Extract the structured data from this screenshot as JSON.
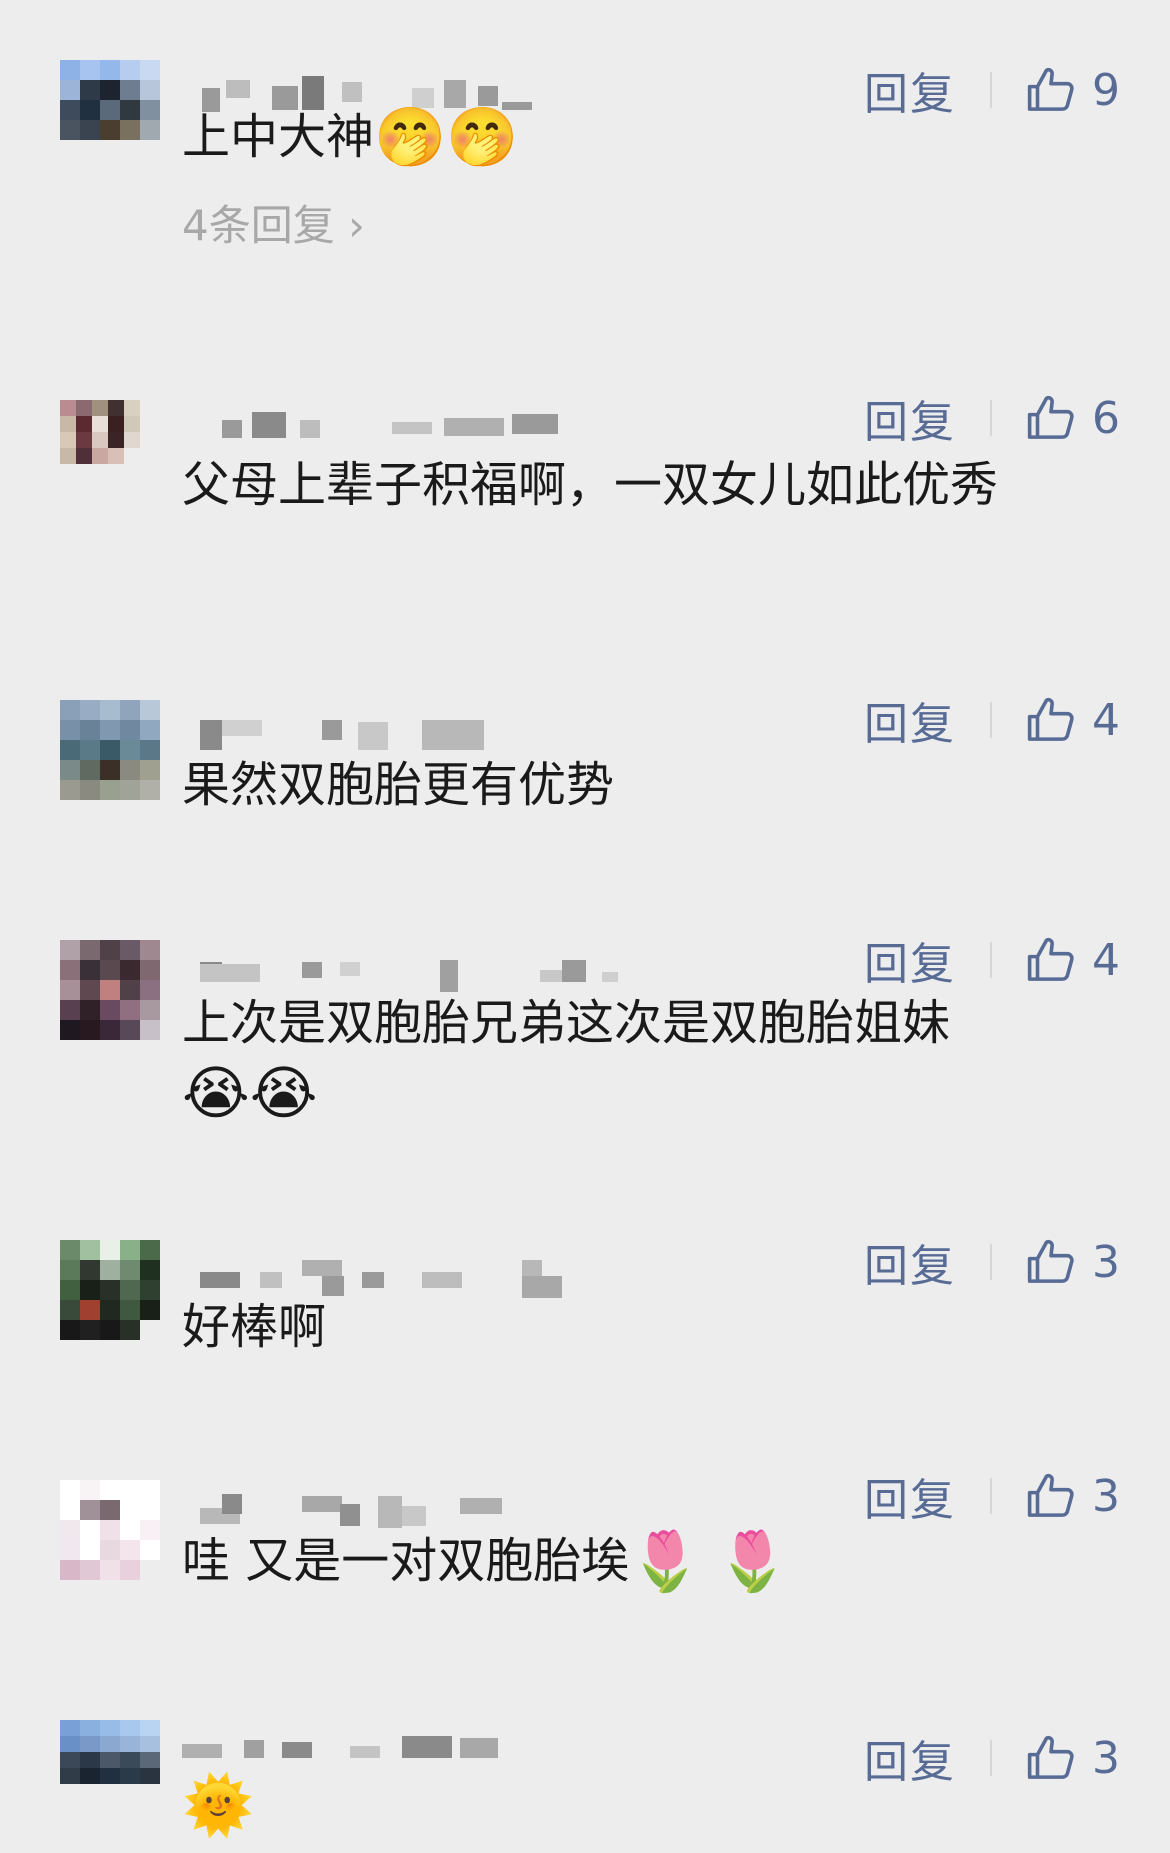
{
  "comments": [
    {
      "reply_label": "回复",
      "likes": "9",
      "text": "上中大神",
      "emojis": [
        "🤭",
        "🤭"
      ],
      "sub_replies": "4条回复",
      "avatar": [
        "#8fb2e6",
        "#a6c4ef",
        "#95b8ea",
        "#b7cdf0",
        "#c9d9f2",
        "#9bb4d8",
        "#2f3a48",
        "#1d2430",
        "#6e7d8f",
        "#b7c6da",
        "#3e4b5c",
        "#203040",
        "#5a6a7a",
        "#303840",
        "#8090a0",
        "#4a5460",
        "#3a4450",
        "#4a3e30",
        "#7a7060",
        "#a0a8b0",
        "#ededed",
        "#ededed",
        "#ededed",
        "#ededed",
        "#ededed"
      ]
    },
    {
      "reply_label": "回复",
      "likes": "6",
      "text": "父母上辈子积福啊，一双女儿如此优秀",
      "emojis": [],
      "sub_replies": "",
      "avatar": [
        "#b88c90",
        "#8a6a70",
        "#a09080",
        "#403030",
        "#d8d0c0",
        "#c8b8a8",
        "#5a2a30",
        "#e8e0d8",
        "#3a2020",
        "#d0c8b8",
        "#d8c8b8",
        "#6a3a40",
        "#d8c8c0",
        "#3a2428",
        "#e0d8d0",
        "#c8b8a8",
        "#503038",
        "#c8a8a0",
        "#d8c0b8",
        "#ededed",
        "#ededed",
        "#ededed",
        "#ededed",
        "#ededed",
        "#ededed"
      ]
    },
    {
      "reply_label": "回复",
      "likes": "4",
      "text": "果然双胞胎更有优势",
      "emojis": [],
      "sub_replies": "",
      "avatar": [
        "#8aa0b8",
        "#98adc4",
        "#a8bcd0",
        "#90a4bc",
        "#b8c8d8",
        "#7890a8",
        "#6a8298",
        "#8098b0",
        "#7088a0",
        "#90a8c0",
        "#4a6a78",
        "#5a7a88",
        "#3a5a68",
        "#6a8a98",
        "#5a7888",
        "#7a8a88",
        "#606a60",
        "#3a3028",
        "#8a8a80",
        "#a0a090",
        "#9a9a90",
        "#8a8a80",
        "#9aa090",
        "#a0a498",
        "#b0b0a8"
      ]
    },
    {
      "reply_label": "回复",
      "likes": "4",
      "text": "上次是双胞胎兄弟这次是双胞胎姐妹",
      "emojis": [
        "😭",
        "😭"
      ],
      "sub_replies": "",
      "avatar": [
        "#b0a0a8",
        "#7a6a70",
        "#504048",
        "#6a5a68",
        "#a08890",
        "#8a7078",
        "#3a3038",
        "#5a4a50",
        "#3a2a30",
        "#806870",
        "#a89098",
        "#604850",
        "#c08080",
        "#504048",
        "#8a7080",
        "#584050",
        "#302028",
        "#6a4a60",
        "#907080",
        "#a898a0",
        "#201820",
        "#281820",
        "#3a2838",
        "#584858",
        "#c8c0c8"
      ]
    },
    {
      "reply_label": "回复",
      "likes": "3",
      "text": "好棒啊",
      "emojis": [],
      "sub_replies": "",
      "avatar": [
        "#6a8a6a",
        "#a0c0a0",
        "#e8f0e8",
        "#8ab08a",
        "#4a6a4a",
        "#5a7a5a",
        "#303830",
        "#a0b0a0",
        "#708a70",
        "#203020",
        "#406040",
        "#182018",
        "#283028",
        "#506850",
        "#304030",
        "#3a4a3a",
        "#a04030",
        "#202820",
        "#405840",
        "#182018",
        "#181818",
        "#202020",
        "#181818",
        "#283028",
        "#ededed"
      ]
    },
    {
      "reply_label": "回复",
      "likes": "3",
      "text": "哇 又是一对双胞胎埃",
      "emojis": [
        "🌷",
        "🌷"
      ],
      "sub_replies": "",
      "avatar": [
        "#ffffff",
        "#f8f4f6",
        "#ffffff",
        "#ffffff",
        "#ffffff",
        "#ffffff",
        "#a09098",
        "#7a6a70",
        "#ffffff",
        "#ffffff",
        "#f0e8ec",
        "#ffffff",
        "#f0e0e8",
        "#ffffff",
        "#f8f0f4",
        "#f0e8ee",
        "#ffffff",
        "#e8d8e0",
        "#f4e4ec",
        "#ffffff",
        "#d8b8c8",
        "#e0c8d4",
        "#f0e0e8",
        "#e8d0dc",
        "#ededed"
      ]
    },
    {
      "reply_label": "回复",
      "likes": "3",
      "text": "",
      "emojis": [
        "🌞"
      ],
      "sub_replies": "",
      "avatar": [
        "#7aa0d8",
        "#8ab0e0",
        "#98bce8",
        "#a8c8ee",
        "#b8d4f2",
        "#6a90c8",
        "#7a98c8",
        "#8aa8d0",
        "#98b4d8",
        "#a8c0e0",
        "#3a4858",
        "#2a3848",
        "#4a5868",
        "#3a4a58",
        "#5a6878",
        "#303c48",
        "#1a2430",
        "#203040",
        "#2a3a48",
        "#2a3440",
        "#ededed",
        "#ededed",
        "#ededed",
        "#ededed",
        "#ededed"
      ]
    }
  ]
}
